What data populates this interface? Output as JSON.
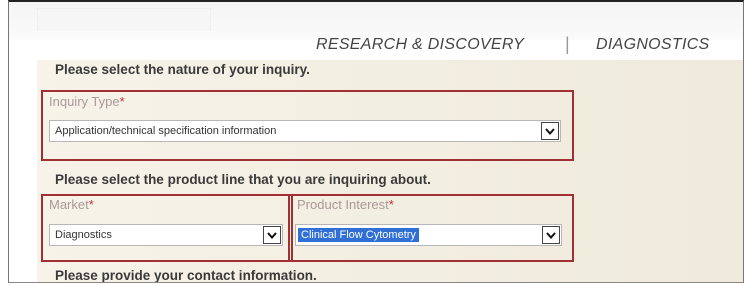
{
  "nav": {
    "research": "RESEARCH & DISCOVERY",
    "separator": "|",
    "diagnostics": "DIAGNOSTICS"
  },
  "form": {
    "nature_prompt": "Please select the nature of your inquiry.",
    "inquiry_type": {
      "label": "Inquiry Type",
      "required_mark": "*",
      "value": "Application/technical specification information"
    },
    "product_line_prompt": "Please select the product line that you are inquiring about.",
    "market": {
      "label": "Market",
      "required_mark": "*",
      "value": "Diagnostics"
    },
    "product_interest": {
      "label": "Product Interest",
      "required_mark": "*",
      "value": "Clinical Flow Cytometry"
    },
    "contact_prompt": "Please provide your contact information."
  },
  "colors": {
    "highlight_border": "#a22f33",
    "selection": "#2f6fd6",
    "required": "#c9322e"
  },
  "icons": {
    "dropdown": "chevron-down-icon"
  }
}
